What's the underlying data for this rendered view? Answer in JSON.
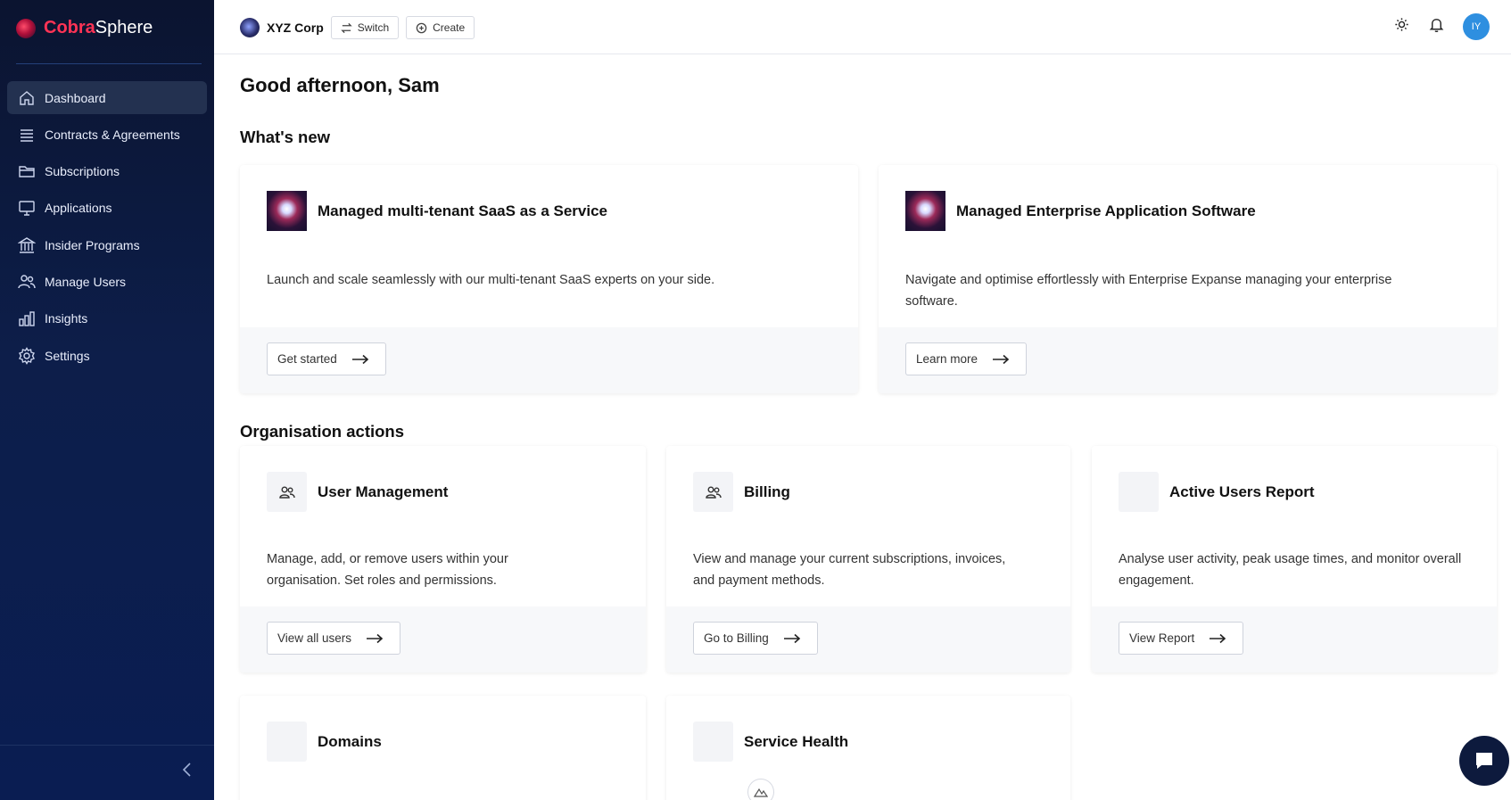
{
  "brand": {
    "name_part1": "Cobra",
    "name_part2": "Sphere"
  },
  "sidebar": {
    "items": [
      {
        "label": "Dashboard",
        "icon": "home-icon",
        "active": true
      },
      {
        "label": "Contracts & Agreements",
        "icon": "list-icon"
      },
      {
        "label": "Subscriptions",
        "icon": "folder-icon"
      },
      {
        "label": "Applications",
        "icon": "monitor-icon"
      },
      {
        "label": "Insider Programs",
        "icon": "bank-icon"
      },
      {
        "label": "Manage Users",
        "icon": "users-icon"
      },
      {
        "label": "Insights",
        "icon": "bar-chart-icon"
      },
      {
        "label": "Settings",
        "icon": "gear-icon"
      }
    ]
  },
  "topbar": {
    "org_name": "XYZ Corp",
    "switch_label": "Switch",
    "create_label": "Create",
    "avatar_initials": "IY"
  },
  "main": {
    "greeting": "Good afternoon, Sam",
    "whats_new_title": "What's new",
    "whats_new": [
      {
        "title": "Managed multi-tenant SaaS as a Service",
        "description": "Launch and scale seamlessly with our multi-tenant SaaS experts on your side.",
        "cta": "Get started"
      },
      {
        "title": "Managed Enterprise Application Software",
        "description": "Navigate and optimise effortlessly with Enterprise Expanse managing your enterprise software.",
        "cta": "Learn more"
      }
    ],
    "org_actions_title": "Organisation actions",
    "org_actions": [
      {
        "title": "User Management",
        "description": "Manage, add, or remove users within your organisation. Set roles and permissions.",
        "cta": "View all users"
      },
      {
        "title": "Billing",
        "description": "View and manage your current subscriptions, invoices, and payment methods.",
        "cta": "Go to Billing"
      },
      {
        "title": "Active Users Report",
        "description": "Analyse user activity, peak usage times, and monitor overall engagement.",
        "cta": "View Report"
      },
      {
        "title": "Domains"
      },
      {
        "title": "Service Health"
      }
    ]
  },
  "colors": {
    "sidebar_bg": "#0d1e4a",
    "brand_accent": "#ff3355",
    "avatar_bg": "#2e8fe0"
  }
}
